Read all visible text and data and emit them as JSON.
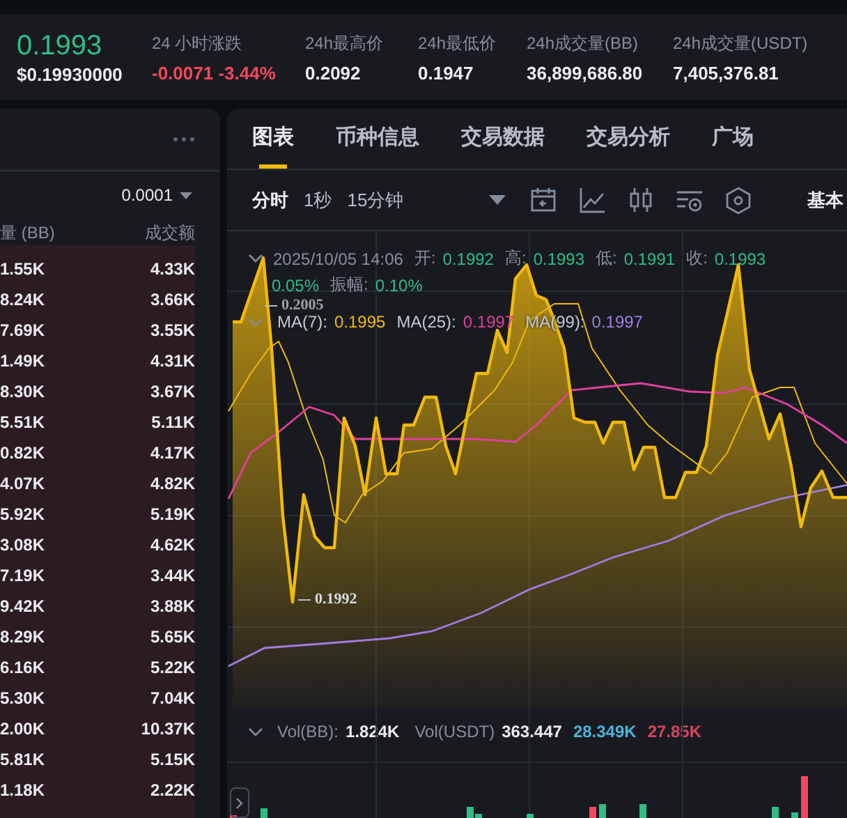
{
  "ticker": {
    "price": "0.1993",
    "usd_price": "$0.19930000",
    "stats": [
      {
        "label": "24 小时涨跌",
        "value": "-0.0071 -3.44%",
        "color": "#f6465d"
      },
      {
        "label": "24h最高价",
        "value": "0.2092",
        "color": "#eaecef"
      },
      {
        "label": "24h最低价",
        "value": "0.1947",
        "color": "#eaecef"
      },
      {
        "label": "24h成交量(BB)",
        "value": "36,899,686.80",
        "color": "#eaecef"
      },
      {
        "label": "24h成交量(USDT)",
        "value": "7,405,376.81",
        "color": "#eaecef"
      }
    ]
  },
  "order_book": {
    "tick_size": "0.0001",
    "columns": [
      "量 (BB)",
      "成交额"
    ],
    "rows": [
      {
        "amount": "1.55K",
        "total": "4.33K"
      },
      {
        "amount": "8.24K",
        "total": "3.66K"
      },
      {
        "amount": "7.69K",
        "total": "3.55K"
      },
      {
        "amount": "1.49K",
        "total": "4.31K"
      },
      {
        "amount": "8.30K",
        "total": "3.67K"
      },
      {
        "amount": "5.51K",
        "total": "5.11K"
      },
      {
        "amount": "0.82K",
        "total": "4.17K"
      },
      {
        "amount": "4.07K",
        "total": "4.82K"
      },
      {
        "amount": "5.92K",
        "total": "5.19K"
      },
      {
        "amount": "3.08K",
        "total": "4.62K"
      },
      {
        "amount": "7.19K",
        "total": "3.44K"
      },
      {
        "amount": "9.42K",
        "total": "3.88K"
      },
      {
        "amount": "8.29K",
        "total": "5.65K"
      },
      {
        "amount": "6.16K",
        "total": "5.22K"
      },
      {
        "amount": "5.30K",
        "total": "7.04K"
      },
      {
        "amount": "2.00K",
        "total": "10.37K"
      },
      {
        "amount": "5.81K",
        "total": "5.15K"
      },
      {
        "amount": "1.18K",
        "total": "2.22K"
      }
    ]
  },
  "tabs": [
    {
      "label": "图表",
      "selected": true
    },
    {
      "label": "币种信息",
      "selected": false
    },
    {
      "label": "交易数据",
      "selected": false
    },
    {
      "label": "交易分析",
      "selected": false
    },
    {
      "label": "广场",
      "selected": false
    }
  ],
  "toolbar": {
    "intervals": [
      {
        "label": "分时",
        "selected": true
      },
      {
        "label": "1秒",
        "selected": false
      },
      {
        "label": "15分钟",
        "selected": false
      }
    ],
    "view": "基本"
  },
  "chart": {
    "info_lines": [
      [
        {
          "kind": "time",
          "text": "2025/10/05 14:06"
        },
        {
          "kind": "label",
          "text": "开:"
        },
        {
          "kind": "value",
          "text": "0.1992"
        },
        {
          "kind": "label",
          "text": "高:"
        },
        {
          "kind": "value",
          "text": "0.1993"
        },
        {
          "kind": "label",
          "text": "低:"
        },
        {
          "kind": "value",
          "text": "0.1991"
        },
        {
          "kind": "label",
          "text": "收:"
        },
        {
          "kind": "value",
          "text": "0.1993"
        }
      ],
      [
        {
          "kind": "value",
          "text": "0.05%"
        },
        {
          "kind": "label",
          "text": "振幅:"
        },
        {
          "kind": "value",
          "text": "0.10%"
        }
      ]
    ],
    "moving_averages": [
      {
        "label": "MA(7):",
        "value": "0.1995",
        "color": "#f0b90b"
      },
      {
        "label": "MA(25):",
        "value": "0.1997",
        "color": "#e0409b"
      },
      {
        "label": "MA(99):",
        "value": "0.1997",
        "color": "#a27ce0"
      }
    ],
    "high_marker": "0.2005",
    "low_marker": "0.1992",
    "volume_legend": [
      {
        "label": "Vol(BB):",
        "value": "1.824K",
        "color": "#eaecef"
      },
      {
        "label": "Vol(USDT)",
        "value": "363.447",
        "color": "#eaecef"
      },
      {
        "value": "28.349K",
        "color": "#4ab4d8"
      },
      {
        "value": "27.85K",
        "color": "#d8435e"
      }
    ]
  }
}
